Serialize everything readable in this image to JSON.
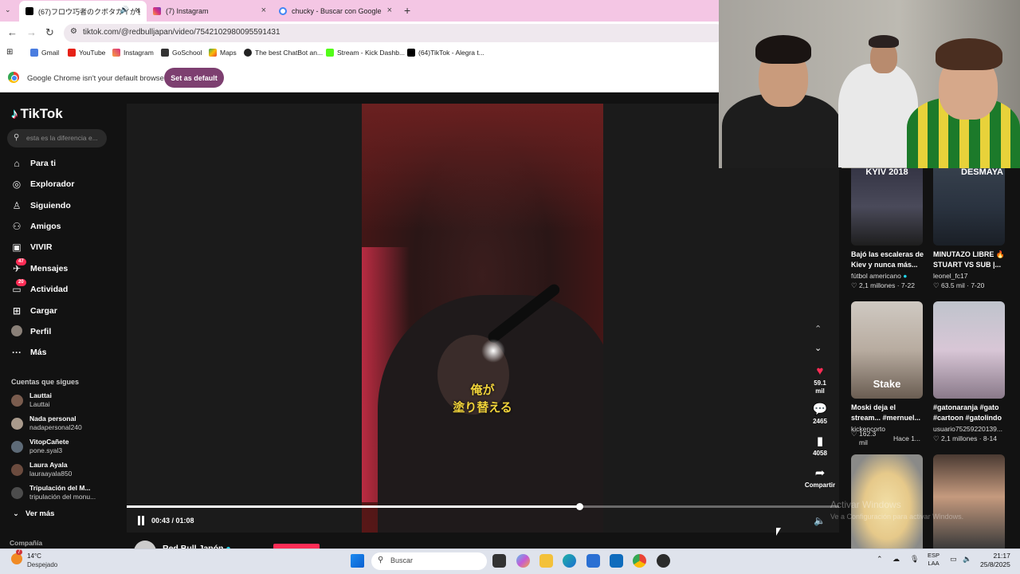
{
  "browser": {
    "tabs": [
      {
        "title": "(67)フロウ巧者のクボタカイが初",
        "active": true
      },
      {
        "title": "(7) Instagram",
        "active": false
      },
      {
        "title": "chucky - Buscar con Google",
        "active": false
      }
    ],
    "new_tab": "+",
    "url": "tiktok.com/@redbulljapan/video/7542102980095591431",
    "bookmarks": [
      "Gmail",
      "YouTube",
      "Instagram",
      "GoSchool",
      "Maps",
      "The best ChatBot an...",
      "Stream - Kick Dashb...",
      "(64)TikTok - Alegra t..."
    ],
    "infobar_message": "Google Chrome isn't your default browser",
    "set_default_label": "Set as default"
  },
  "tiktok": {
    "logo": "TikTok",
    "search_placeholder": "esta es la diferencia e...",
    "nav": [
      {
        "label": "Para ti",
        "icon": "home-icon"
      },
      {
        "label": "Explorador",
        "icon": "compass-icon"
      },
      {
        "label": "Siguiendo",
        "icon": "following-icon"
      },
      {
        "label": "Amigos",
        "icon": "friends-icon"
      },
      {
        "label": "VIVIR",
        "icon": "live-icon"
      },
      {
        "label": "Mensajes",
        "icon": "messages-icon",
        "badge": "47"
      },
      {
        "label": "Actividad",
        "icon": "activity-icon",
        "badge": "20"
      },
      {
        "label": "Cargar",
        "icon": "upload-icon"
      },
      {
        "label": "Perfil",
        "icon": "profile-icon"
      },
      {
        "label": "Más",
        "icon": "more-icon"
      }
    ],
    "following_title": "Cuentas que sigues",
    "following": [
      {
        "name": "Lauttai",
        "handle": "Lauttai"
      },
      {
        "name": "Nada personal",
        "handle": "nadapersonal240"
      },
      {
        "name": "VitopCañete",
        "handle": "pone.syal3"
      },
      {
        "name": "Laura Ayala",
        "handle": "lauraayala850"
      },
      {
        "name": "Tripulación del M...",
        "handle": "tripulación del monu..."
      }
    ],
    "ver_mas": "Ver más",
    "compania": "Compañía"
  },
  "video": {
    "subtitle_line1": "俺が",
    "subtitle_line2": "塗り替える",
    "time": "00:43 / 01:08",
    "progress": 0.635,
    "author": "Red Bull Japón",
    "likes": "59.1",
    "likes_unit": "mil",
    "comments": "2465",
    "saves": "4058",
    "share_label": "Compartir"
  },
  "recommended": [
    {
      "overlay": "KYIV 2018",
      "title": "Bajó las escaleras de Kiev y nunca más...",
      "user": "fútbol americano",
      "likes": "2,1 millones",
      "date": "7-22",
      "verified": true
    },
    {
      "overlay": "DESMAYA",
      "title": "MINUTAZO LIBRE 🔥 STUART VS SUB |...",
      "user": "leonel_fc17",
      "likes": "63.5 mil",
      "date": "7-20"
    },
    {
      "overlay": "Stake",
      "title": "Moski deja el stream... #mernuel...",
      "user": "kickencorto",
      "likes": "162.3",
      "likes2": "mil",
      "date": "Hace 1..."
    },
    {
      "overlay": "",
      "title": "#gatonaranja #gato #cartoon #gatolindo",
      "user": "usuario75259220139...",
      "likes": "2,1 millones",
      "date": "8-14"
    },
    {
      "overlay": "",
      "title": "",
      "user": "",
      "likes": "",
      "date": ""
    },
    {
      "overlay": "",
      "title": "",
      "user": "",
      "likes": "",
      "date": ""
    }
  ],
  "watermark": {
    "title": "Activar Windows",
    "sub": "Ve a Configuración para activar Windows."
  },
  "taskbar": {
    "weather_badge": "7",
    "temp": "14°C",
    "weather": "Despejado",
    "search": "Buscar",
    "lang1": "ESP",
    "lang2": "LAA",
    "time": "21:17",
    "date": "25/8/2025"
  },
  "colors": {
    "accent": "#fe2c55",
    "chrome_tab": "#f4c6e4",
    "set_default": "#7d3f70"
  }
}
